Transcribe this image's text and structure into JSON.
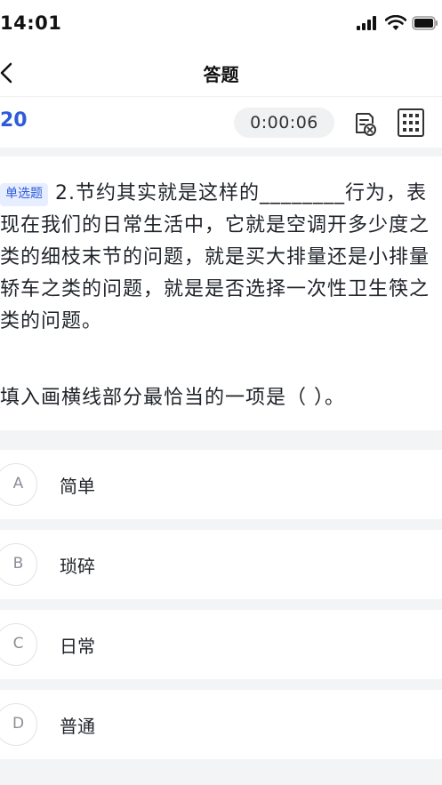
{
  "status_bar": {
    "time": "14:01"
  },
  "nav": {
    "title": "答题"
  },
  "info_bar": {
    "question_count": "20",
    "timer": "0:00:06"
  },
  "question": {
    "type_badge": "单选题",
    "text": "2.节约其实就是这样的________行为，表现在我们的日常生活中，它就是空调开多少度之类的细枝末节的问题，就是买大排量还是小排量轿车之类的问题，就是是否选择一次性卫生筷之类的问题。",
    "instruction": "填入画横线部分最恰当的一项是（ ）。"
  },
  "options": [
    {
      "letter": "A",
      "text": "简单"
    },
    {
      "letter": "B",
      "text": "琐碎"
    },
    {
      "letter": "C",
      "text": "日常"
    },
    {
      "letter": "D",
      "text": "普通"
    }
  ],
  "colors": {
    "accent": "#2f5bd8",
    "background": "#f3f4f6",
    "badge_bg": "#e7eeff"
  }
}
